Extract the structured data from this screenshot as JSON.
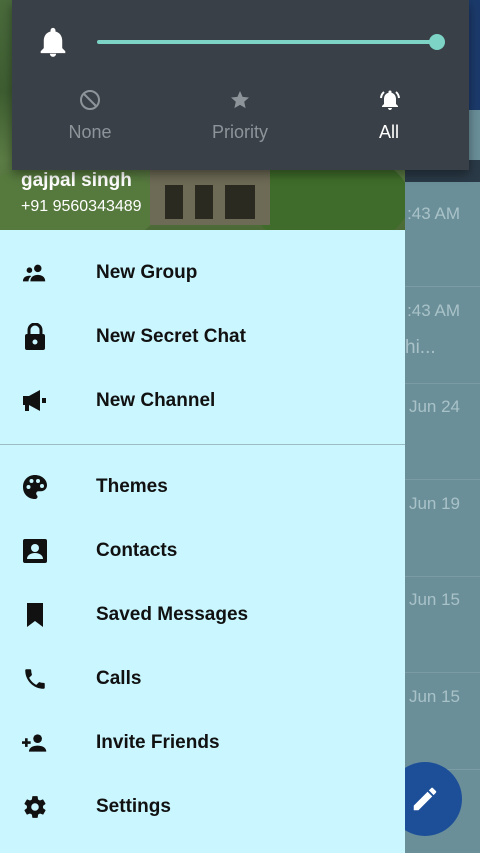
{
  "background_chats": [
    {
      "time": ":43 AM",
      "sub": ""
    },
    {
      "time": ":43 AM",
      "sub": "hi..."
    },
    {
      "time": "Jun 24",
      "sub": ""
    },
    {
      "time": "Jun 19",
      "sub": ""
    },
    {
      "time": "Jun 15",
      "sub": ""
    },
    {
      "time": "Jun 15",
      "sub": ""
    }
  ],
  "drawer": {
    "user_name": "gajpal singh",
    "user_phone": "+91 9560343489",
    "menu_top": [
      {
        "label": "New Group",
        "icon": "group-icon"
      },
      {
        "label": "New Secret Chat",
        "icon": "lock-icon"
      },
      {
        "label": "New Channel",
        "icon": "megaphone-icon"
      }
    ],
    "menu_bottom": [
      {
        "label": "Themes",
        "icon": "palette-icon"
      },
      {
        "label": "Contacts",
        "icon": "contact-card-icon"
      },
      {
        "label": "Saved Messages",
        "icon": "bookmark-icon"
      },
      {
        "label": "Calls",
        "icon": "phone-icon"
      },
      {
        "label": "Invite Friends",
        "icon": "add-person-icon"
      },
      {
        "label": "Settings",
        "icon": "gear-icon"
      }
    ]
  },
  "dnd_panel": {
    "volume_level": 1.0,
    "modes": [
      {
        "label": "None",
        "icon": "block-icon",
        "active": false
      },
      {
        "label": "Priority",
        "icon": "star-icon",
        "active": false
      },
      {
        "label": "All",
        "icon": "bell-ring-icon",
        "active": true
      }
    ],
    "accent_color": "#7cd3c6"
  },
  "colors": {
    "drawer_bg": "#c9f6ff",
    "panel_bg": "#3a4047",
    "fab_bg": "#1d4f99"
  }
}
